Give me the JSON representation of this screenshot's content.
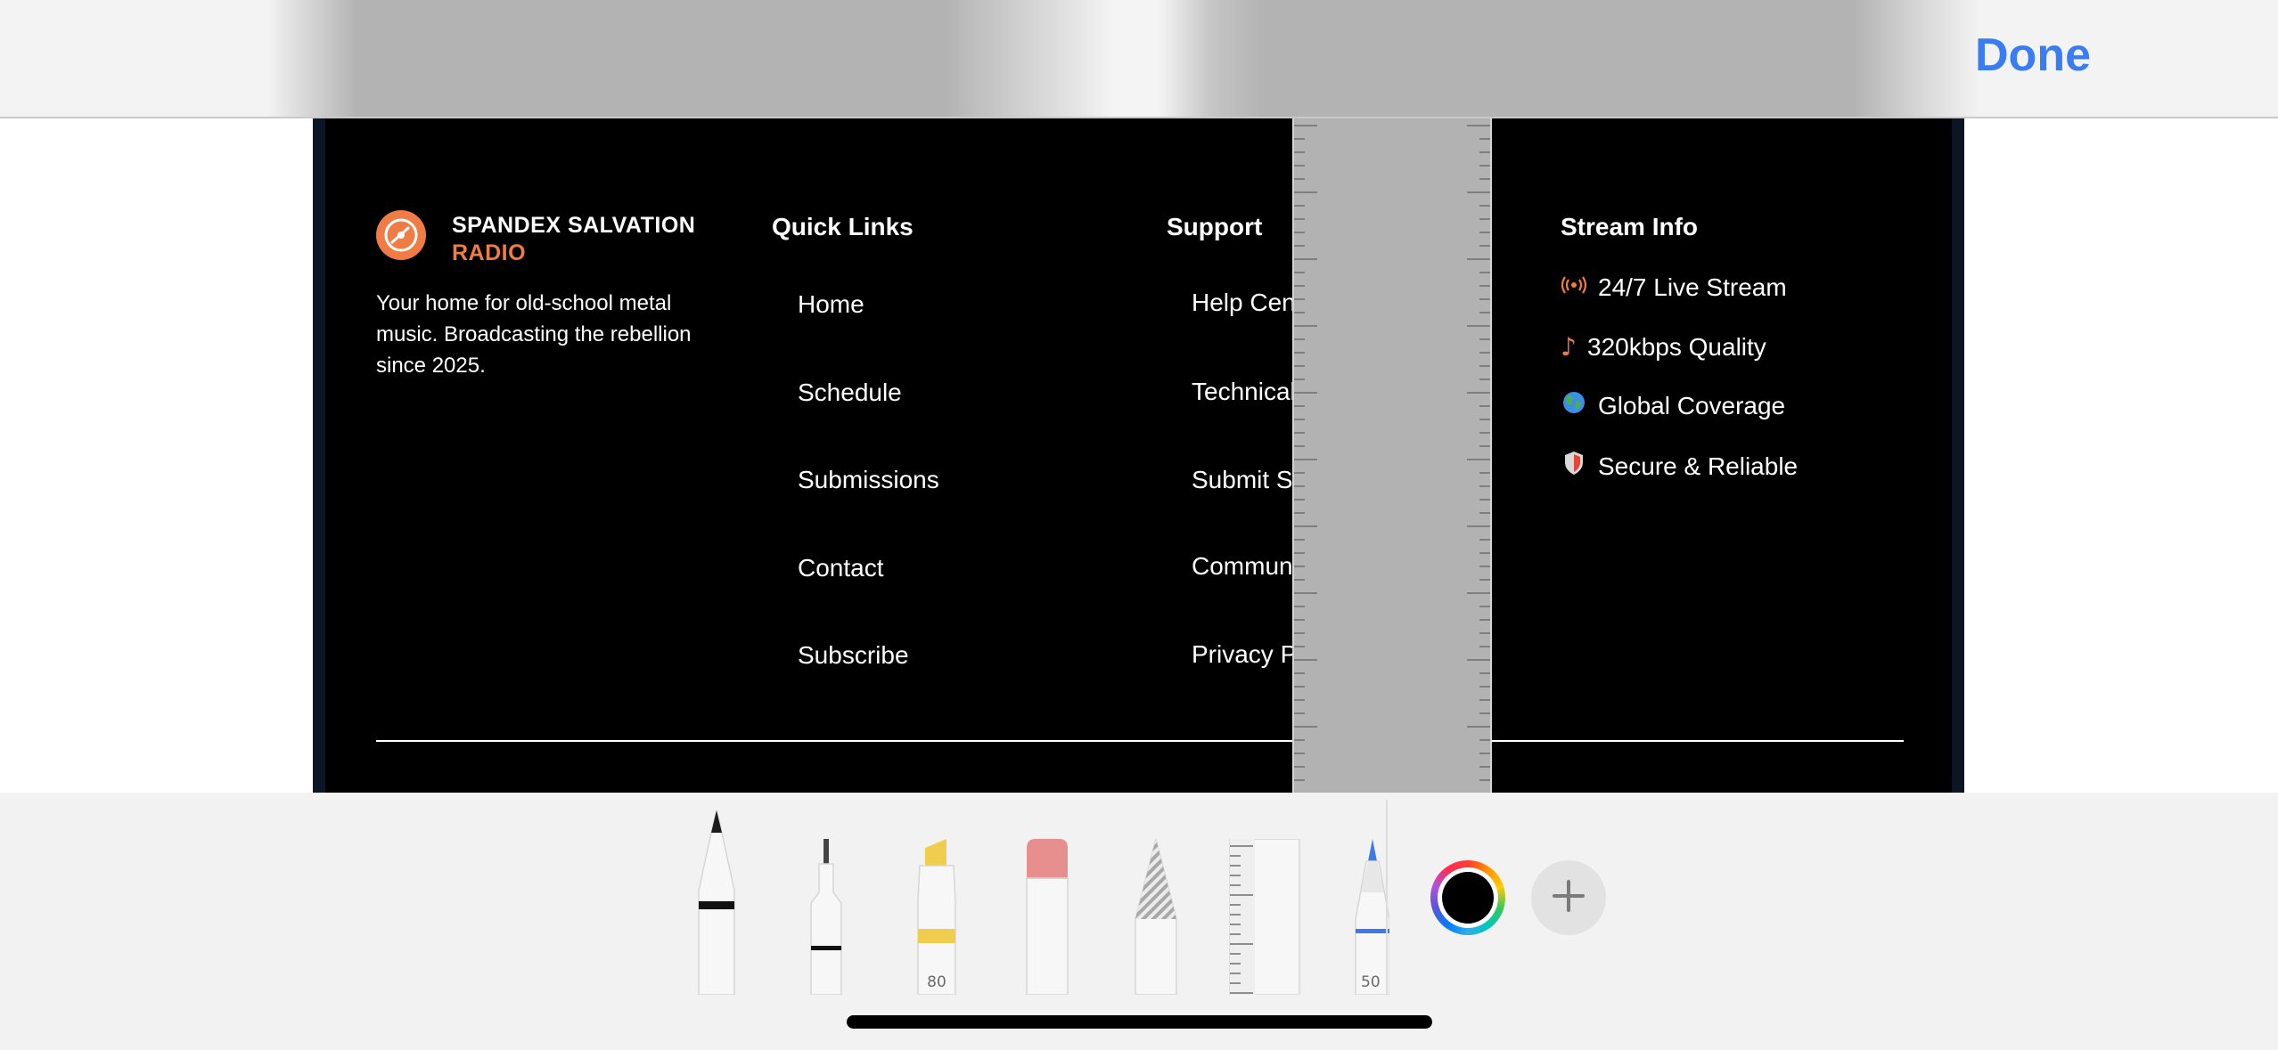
{
  "topbar": {
    "done_label": "Done"
  },
  "footer": {
    "brand": {
      "name_line1": "SPANDEX SALVATION",
      "name_line2": "RADIO",
      "description": "Your home for old-school metal music. Broadcasting the rebellion since 2025.",
      "logo_icon": "vinyl-disc-icon",
      "accent_color": "#ef7c45"
    },
    "quick_links": {
      "title": "Quick Links",
      "items": [
        "Home",
        "Schedule",
        "Submissions",
        "Contact",
        "Subscribe"
      ]
    },
    "support": {
      "title": "Support",
      "items": [
        "Help Center",
        "Technical Support",
        "Submit Songs",
        "Community Guidelines",
        "Privacy Policy"
      ]
    },
    "stream_info": {
      "title": "Stream Info",
      "items": [
        {
          "icon": "broadcast-icon",
          "label": "24/7 Live Stream"
        },
        {
          "icon": "music-note-icon",
          "label": "320kbps Quality"
        },
        {
          "icon": "globe-icon",
          "label": "Global Coverage"
        },
        {
          "icon": "shield-icon",
          "label": "Secure & Reliable"
        }
      ]
    }
  },
  "palette": {
    "tools": [
      {
        "name": "pen",
        "label": ""
      },
      {
        "name": "fineliner",
        "label": ""
      },
      {
        "name": "highlighter",
        "label": "80"
      },
      {
        "name": "eraser",
        "label": ""
      },
      {
        "name": "lasso",
        "label": ""
      },
      {
        "name": "ruler",
        "label": ""
      },
      {
        "name": "crayon",
        "label": "50"
      }
    ],
    "current_color": "#000000",
    "add_icon": "plus-icon"
  }
}
